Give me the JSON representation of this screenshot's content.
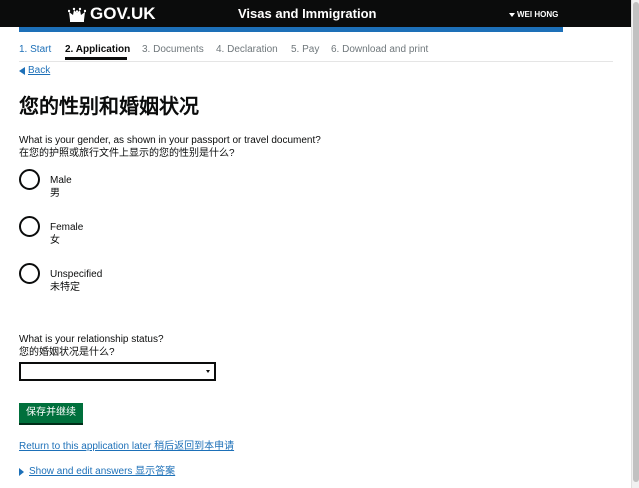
{
  "header": {
    "logo_text": "GOV.UK",
    "service_name": "Visas and Immigration",
    "user_name": "WEI HONG"
  },
  "steps": [
    {
      "label": "1. Start",
      "state": "done"
    },
    {
      "label": "2. Application",
      "state": "current"
    },
    {
      "label": "3. Documents",
      "state": "todo"
    },
    {
      "label": "4. Declaration",
      "state": "todo"
    },
    {
      "label": "5. Pay",
      "state": "todo"
    },
    {
      "label": "6. Download and print",
      "state": "todo"
    }
  ],
  "back_link": "Back",
  "page_title": "您的性别和婚姻状况",
  "gender_question": {
    "en": "What is your gender, as shown in your passport or travel document?",
    "zh": "在您的护照或旅行文件上显示的您的性别是什么?"
  },
  "gender_options": [
    {
      "en": "Male",
      "zh": "男"
    },
    {
      "en": "Female",
      "zh": "女"
    },
    {
      "en": "Unspecified",
      "zh": "未特定"
    }
  ],
  "relationship_question": {
    "en": "What is your relationship status?",
    "zh": "您的婚姻状况是什么?"
  },
  "relationship_select_value": "",
  "save_button": "保存并继续",
  "return_later_link": "Return to this application later 稍后返回到本申请",
  "show_answers_link": "Show and edit answers 显示答案",
  "colors": {
    "header_bg": "#0b0c0c",
    "accent_blue": "#1d70b8",
    "button_green": "#00703c"
  },
  "icons": {
    "logo": "crown-icon",
    "user_menu": "triangle-down-icon",
    "back": "triangle-left-icon",
    "show_answers": "triangle-right-icon"
  }
}
